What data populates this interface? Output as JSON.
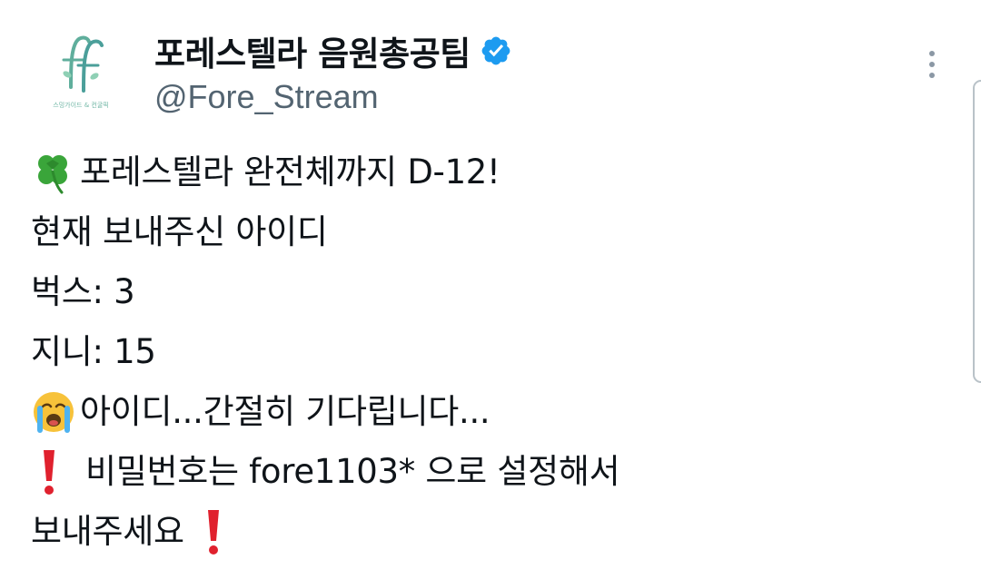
{
  "author": {
    "display_name": "포레스텔라 음원총공팀",
    "handle": "@Fore_Stream",
    "verified": true,
    "avatar_caption": "스밍가이드 & 컨굴픽",
    "avatar_monogram": "ff"
  },
  "tweet": {
    "lines": [
      {
        "emoji": "four-leaf-clover",
        "text": "포레스텔라 완전체까지 D-12!"
      },
      {
        "emoji": "",
        "text": "현재 보내주신 아이디"
      },
      {
        "emoji": "",
        "text": "벅스: 3"
      },
      {
        "emoji": "",
        "text": "지니: 15"
      },
      {
        "emoji": "crying-face",
        "text": "아이디...간절히 기다립니다..."
      },
      {
        "emoji": "exclamation-mark",
        "text": "비밀번호는 fore1103* 으로 설정해서"
      },
      {
        "emoji": "",
        "text": "보내주세요",
        "trailing_emoji": "exclamation-mark"
      }
    ]
  },
  "colors": {
    "text": "#0f1419",
    "secondary": "#536471",
    "verified": "#1d9bf0",
    "clover": "#3aa53a",
    "exclamation": "#e0212e",
    "monogram": "#5fae9c"
  },
  "icons": {
    "verified": "verified-badge-icon",
    "more": "more-vertical-icon"
  }
}
